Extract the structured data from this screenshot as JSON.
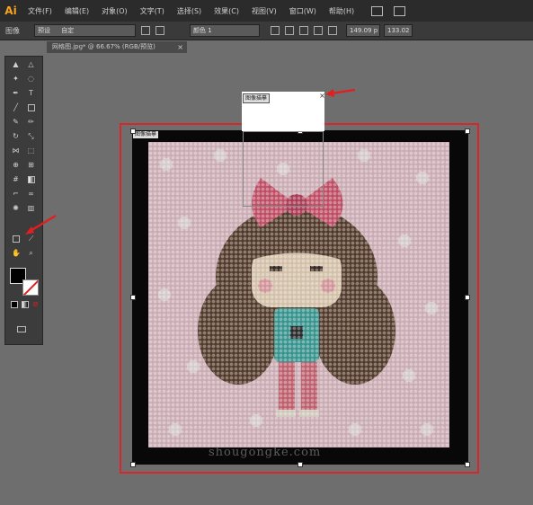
{
  "app": {
    "logo": "Ai"
  },
  "menubar": {
    "items": [
      "文件(F)",
      "编辑(E)",
      "对象(O)",
      "文字(T)",
      "选择(S)",
      "效果(C)",
      "视图(V)",
      "窗口(W)",
      "帮助(H)"
    ]
  },
  "controlbar": {
    "object_label": "图像",
    "preset_label": "预设",
    "preset_value": "自定",
    "mode_value": "颜色 1",
    "width_value": "149.09 p",
    "height_value": "133.02"
  },
  "document_tab": {
    "title": "网格图.jpg* @ 66.67% (RGB/预览)",
    "close": "×"
  },
  "canvas": {
    "artboard_label": "图像描摹",
    "popup_label": "图像描摹",
    "popup_close": "×",
    "watermark": "shougongke.com"
  },
  "tools": {
    "icons": [
      "selection-icon",
      "direct-selection-icon",
      "magic-wand-icon",
      "lasso-icon",
      "pen-icon",
      "type-icon",
      "line-icon",
      "rectangle-icon",
      "paintbrush-icon",
      "pencil-icon",
      "rotate-icon",
      "scale-icon",
      "width-icon",
      "free-transform-icon",
      "shape-builder-icon",
      "perspective-icon",
      "mesh-icon",
      "gradient-icon",
      "eyedropper-icon",
      "blend-icon",
      "symbol-sprayer-icon",
      "column-graph-icon",
      "artboard-icon",
      "slice-icon",
      "hand-icon",
      "zoom-icon"
    ]
  },
  "colors": {
    "highlight_red": "#d9262a",
    "arrow_red": "#e02020",
    "pink_bg": "#e8c4cc",
    "bow": "#d9536f",
    "hair": "#5a3e2b",
    "face": "#f3dcc0",
    "shirt": "#3aa7a0",
    "legs": "#d96a7a"
  }
}
